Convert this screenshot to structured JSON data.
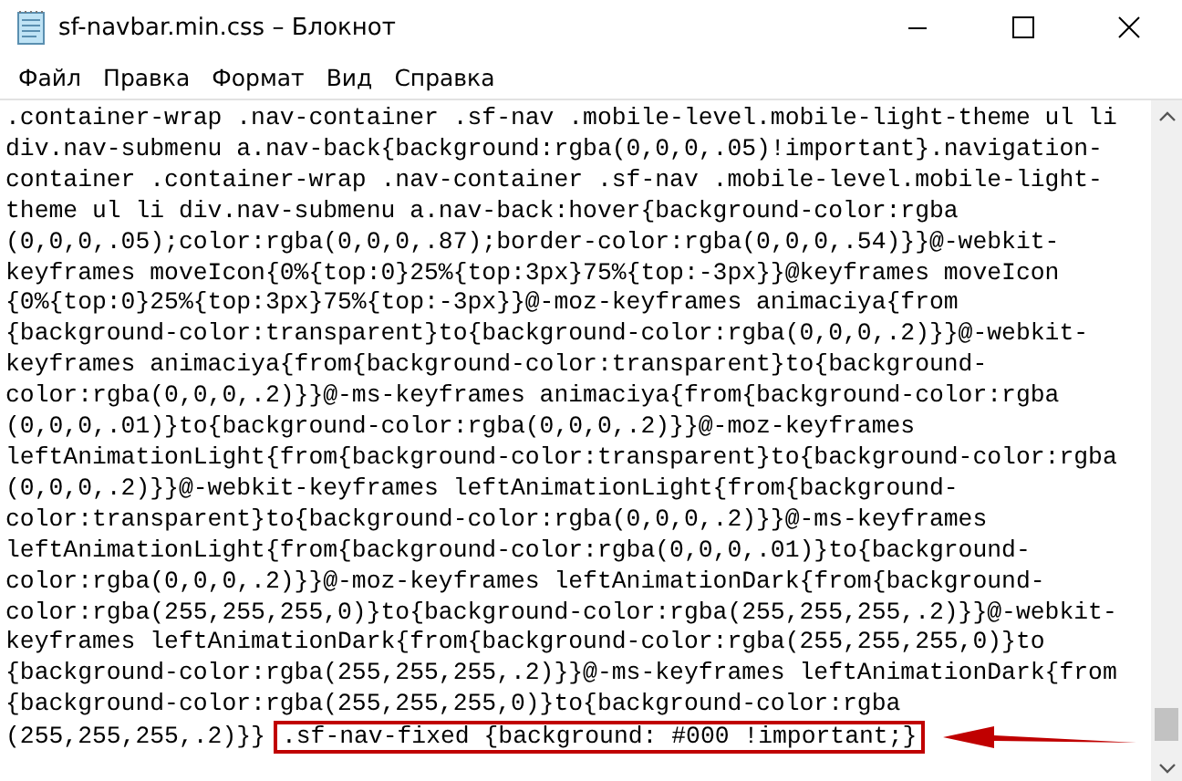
{
  "window": {
    "title": "sf-navbar.min.css – Блокнот"
  },
  "menu": [
    "Файл",
    "Правка",
    "Формат",
    "Вид",
    "Справка"
  ],
  "editor": {
    "lines": [
      ".container-wrap .nav-container .sf-nav .mobile-level.mobile-light-theme ul li",
      "div.nav-submenu a.nav-back{background:rgba(0,0,0,.05)!important}.navigation-",
      "container .container-wrap .nav-container .sf-nav .mobile-level.mobile-light-",
      "theme ul li div.nav-submenu a.nav-back:hover{background-color:rgba",
      "(0,0,0,.05);color:rgba(0,0,0,.87);border-color:rgba(0,0,0,.54)}}@-webkit-",
      "keyframes moveIcon{0%{top:0}25%{top:3px}75%{top:-3px}}@keyframes moveIcon",
      "{0%{top:0}25%{top:3px}75%{top:-3px}}@-moz-keyframes animaciya{from",
      "{background-color:transparent}to{background-color:rgba(0,0,0,.2)}}@-webkit-",
      "keyframes animaciya{from{background-color:transparent}to{background-",
      "color:rgba(0,0,0,.2)}}@-ms-keyframes animaciya{from{background-color:rgba",
      "(0,0,0,.01)}to{background-color:rgba(0,0,0,.2)}}@-moz-keyframes",
      "leftAnimationLight{from{background-color:transparent}to{background-color:rgba",
      "(0,0,0,.2)}}@-webkit-keyframes leftAnimationLight{from{background-",
      "color:transparent}to{background-color:rgba(0,0,0,.2)}}@-ms-keyframes",
      "leftAnimationLight{from{background-color:rgba(0,0,0,.01)}to{background-",
      "color:rgba(0,0,0,.2)}}@-moz-keyframes leftAnimationDark{from{background-",
      "color:rgba(255,255,255,0)}to{background-color:rgba(255,255,255,.2)}}@-webkit-",
      "keyframes leftAnimationDark{from{background-color:rgba(255,255,255,0)}to",
      "{background-color:rgba(255,255,255,.2)}}@-ms-keyframes leftAnimationDark{from",
      "{background-color:rgba(255,255,255,0)}to{background-color:rgba",
      "(255,255,255,.2)}}"
    ],
    "highlighted_text": ".sf-nav-fixed {background: #000 !important;}"
  }
}
